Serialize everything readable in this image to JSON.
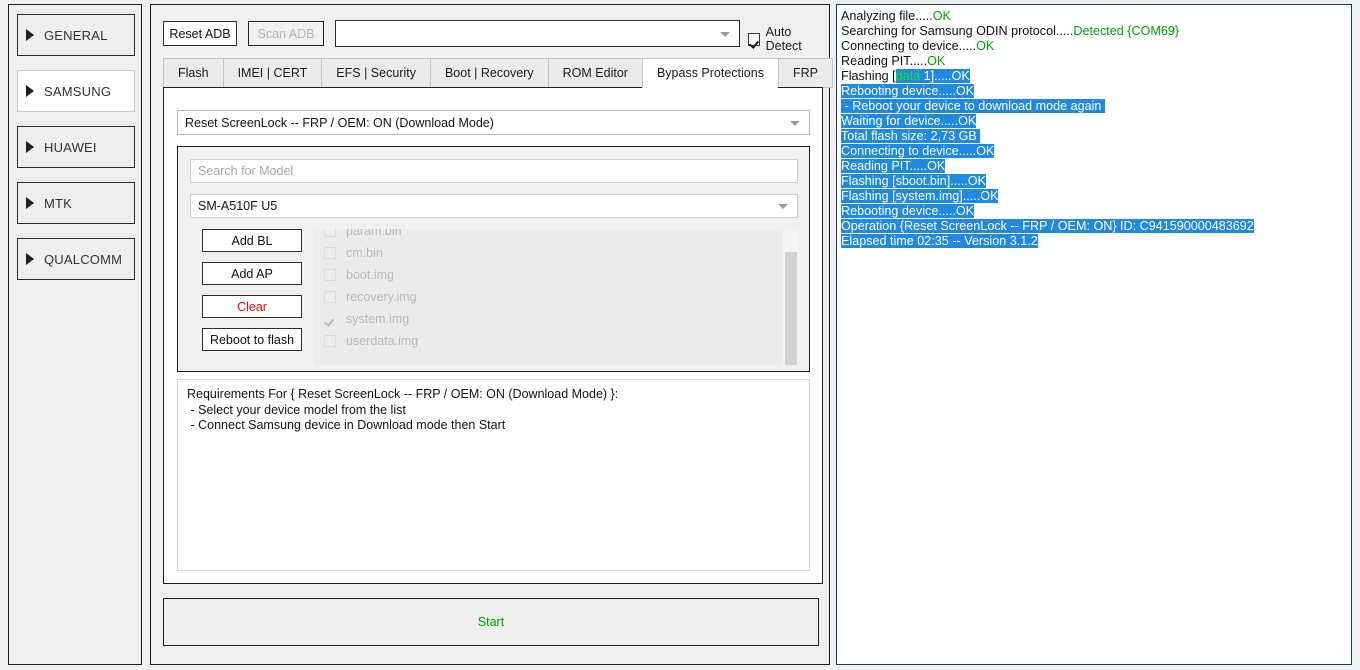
{
  "sidebar": {
    "items": [
      {
        "label": "GENERAL",
        "selected": false
      },
      {
        "label": "SAMSUNG",
        "selected": true
      },
      {
        "label": "HUAWEI",
        "selected": false
      },
      {
        "label": "MTK",
        "selected": false
      },
      {
        "label": "QUALCOMM",
        "selected": false
      }
    ]
  },
  "toolbar": {
    "reset_adb_label": "Reset ADB",
    "scan_adb_label": "Scan ADB",
    "device_combo_value": "",
    "auto_detect_label": "Auto Detect",
    "auto_detect_checked": true
  },
  "tabs": [
    {
      "label": "Flash",
      "active": false
    },
    {
      "label": "IMEI | CERT",
      "active": false
    },
    {
      "label": "EFS | Security",
      "active": false
    },
    {
      "label": "Boot | Recovery",
      "active": false
    },
    {
      "label": "ROM Editor",
      "active": false
    },
    {
      "label": "Bypass Protections",
      "active": true
    },
    {
      "label": "FRP",
      "active": false
    }
  ],
  "operation": {
    "selected": "Reset ScreenLock -- FRP / OEM: ON (Download Mode)"
  },
  "model_group": {
    "search_placeholder": "Search for Model",
    "search_value": "",
    "model_selected": "SM-A510F U5",
    "buttons": [
      {
        "label": "Add BL",
        "style": "normal"
      },
      {
        "label": "Add AP",
        "style": "normal"
      },
      {
        "label": "Clear",
        "style": "danger"
      },
      {
        "label": "Reboot to flash",
        "style": "normal"
      }
    ],
    "files": [
      {
        "name": "param.bin",
        "checked": false
      },
      {
        "name": "cm.bin",
        "checked": false
      },
      {
        "name": "boot.img",
        "checked": false
      },
      {
        "name": "recovery.img",
        "checked": false
      },
      {
        "name": "system.img",
        "checked": true
      },
      {
        "name": "userdata.img",
        "checked": false
      }
    ]
  },
  "requirements": {
    "text": "Requirements For { Reset ScreenLock -- FRP / OEM: ON (Download Mode) }:\n - Select your device model from the list\n - Connect Samsung device in Download mode then Start"
  },
  "start_button": {
    "label": "Start"
  },
  "log": {
    "lines": [
      {
        "parts": [
          {
            "t": "Analyzing file.....",
            "c": "plain"
          },
          {
            "t": "OK",
            "c": "green"
          }
        ]
      },
      {
        "parts": [
          {
            "t": "Searching for Samsung ODIN protocol.....",
            "c": "plain"
          },
          {
            "t": "Detected {COM69}",
            "c": "green"
          }
        ]
      },
      {
        "parts": [
          {
            "t": "Connecting to device.....",
            "c": "plain"
          },
          {
            "t": "OK",
            "c": "green"
          }
        ]
      },
      {
        "parts": [
          {
            "t": "Reading PIT.....",
            "c": "plain"
          },
          {
            "t": "OK",
            "c": "green"
          }
        ]
      },
      {
        "parts": [
          {
            "t": "Flashing [",
            "c": "plain"
          },
          {
            "t": "data",
            "c": "green-sel"
          },
          {
            "t": " 1].....OK",
            "c": "sel"
          }
        ]
      },
      {
        "parts": [
          {
            "t": "Rebooting device.....OK",
            "c": "sel"
          }
        ]
      },
      {
        "parts": [
          {
            "t": " - Reboot your device to download mode again ",
            "c": "sel"
          }
        ]
      },
      {
        "parts": [
          {
            "t": "Waiting for device.....OK",
            "c": "sel"
          }
        ]
      },
      {
        "parts": [
          {
            "t": "Total flash size: 2,73 GB ",
            "c": "sel"
          }
        ]
      },
      {
        "parts": [
          {
            "t": "Connecting to device.....OK",
            "c": "sel"
          }
        ]
      },
      {
        "parts": [
          {
            "t": "Reading PIT.....OK",
            "c": "sel"
          }
        ]
      },
      {
        "parts": [
          {
            "t": "Flashing [sboot.bin].....OK",
            "c": "sel"
          }
        ]
      },
      {
        "parts": [
          {
            "t": "Flashing [system.img].....OK",
            "c": "sel"
          }
        ]
      },
      {
        "parts": [
          {
            "t": "Rebooting device.....OK",
            "c": "sel"
          }
        ]
      },
      {
        "parts": [
          {
            "t": "Operation {Reset ScreenLock -- FRP / OEM: ON} ID: C941590000483692",
            "c": "sel"
          }
        ]
      },
      {
        "parts": [
          {
            "t": "Elapsed time 02:35 -- Version 3.1.2",
            "c": "sel"
          }
        ]
      }
    ]
  },
  "colors": {
    "accent_green": "#00a400",
    "selection_blue": "#1f8ae0",
    "danger_red": "#ff0000",
    "panel_bg": "#f0f0f0"
  }
}
